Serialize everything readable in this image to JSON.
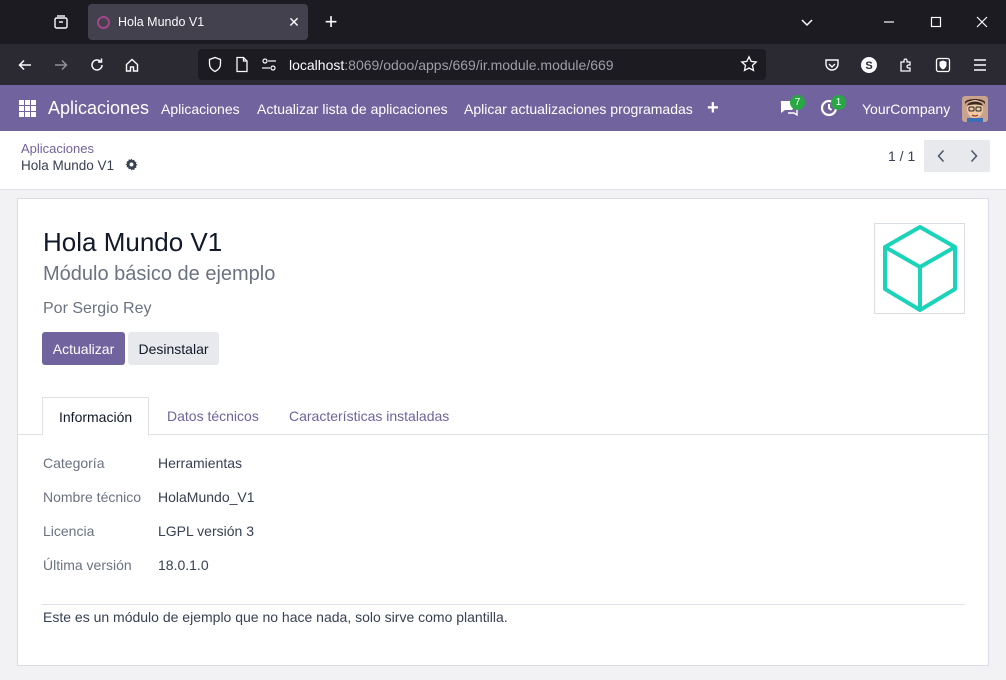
{
  "browser": {
    "tab_title": "Hola Mundo V1",
    "url_host": "localhost",
    "url_path": ":8069/odoo/apps/669/ir.module.module/669"
  },
  "odoo_nav": {
    "brand": "Aplicaciones",
    "menu": [
      "Aplicaciones",
      "Actualizar lista de aplicaciones",
      "Aplicar actualizaciones programadas"
    ],
    "messages_count": "7",
    "activities_count": "1",
    "company": "YourCompany"
  },
  "breadcrumb": {
    "parent": "Aplicaciones",
    "current": "Hola Mundo V1"
  },
  "pager": {
    "value": "1 / 1"
  },
  "module": {
    "title": "Hola Mundo V1",
    "summary": "Módulo básico de ejemplo",
    "author": "Por Sergio Rey",
    "btn_update": "Actualizar",
    "btn_uninstall": "Desinstalar",
    "tabs": [
      "Información",
      "Datos técnicos",
      "Características instaladas"
    ],
    "fields": [
      {
        "label": "Categoría",
        "value": "Herramientas"
      },
      {
        "label": "Nombre técnico",
        "value": "HolaMundo_V1"
      },
      {
        "label": "Licencia",
        "value": "LGPL versión 3"
      },
      {
        "label": "Última versión",
        "value": "18.0.1.0"
      }
    ],
    "description": "Este es un módulo de ejemplo que no hace nada, solo sirve como plantilla."
  },
  "colors": {
    "odoo_primary": "#71639e",
    "badge_green": "#28a745",
    "module_icon": "#1ad3b8"
  }
}
